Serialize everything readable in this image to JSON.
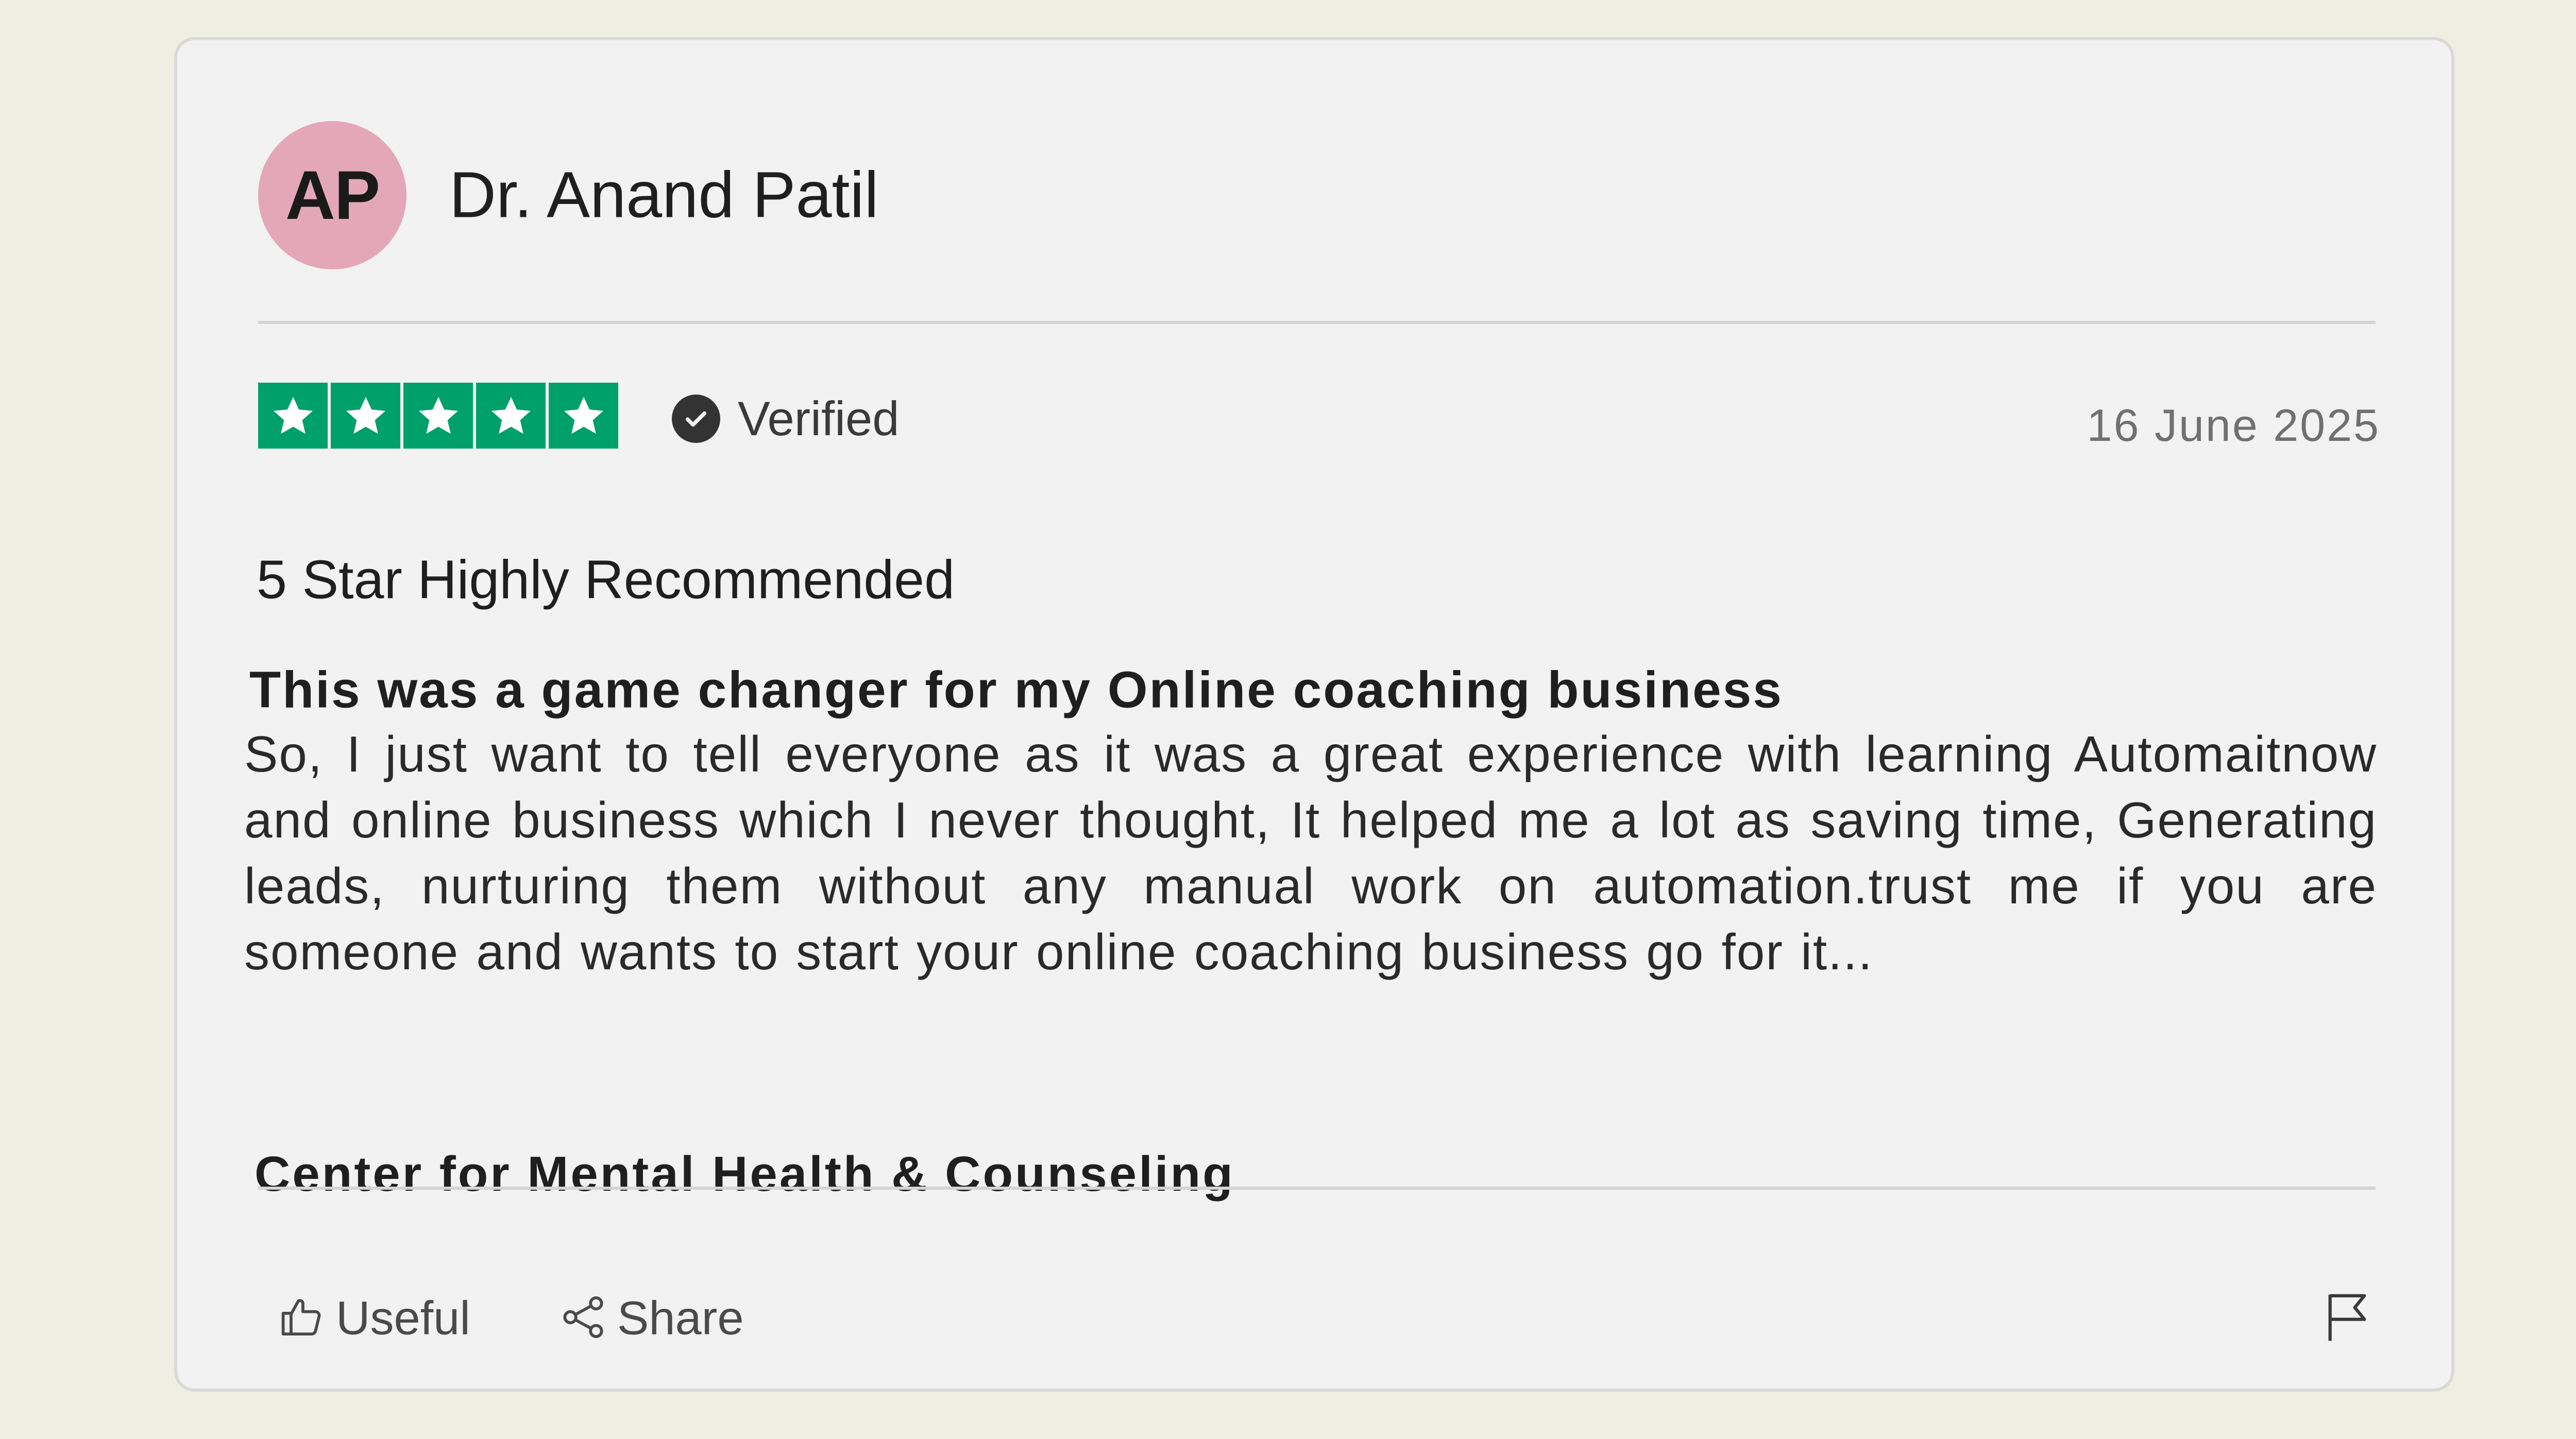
{
  "reviewer": {
    "initials": "AP",
    "name": "Dr. Anand Patil"
  },
  "rating": {
    "stars": 5,
    "max_stars": 5,
    "star_color": "#00a06a",
    "verified_label": "Verified"
  },
  "review": {
    "date": "16 June 2025",
    "headline": "5 Star Highly Recommended",
    "title": "This was a game changer for my Online coaching business",
    "body": "So, I just want to tell everyone as it was a great experience with learning Automaitnow and online business which I never thought, It helped me a lot as saving time, Generating leads, nurturing them without any manual work on automation.trust me if you are someone and wants to start your online coaching business go for it...",
    "organization": "Center for Mental Health & Counseling"
  },
  "actions": {
    "useful_label": "Useful",
    "share_label": "Share"
  },
  "icons": {
    "useful": "thumbs-up-icon",
    "share": "share-icon",
    "flag": "flag-icon",
    "verified": "check-circle-icon",
    "star": "star-icon"
  },
  "colors": {
    "background": "#eeeee2",
    "card": "#f2f2f2",
    "avatar": "#e4a7ba",
    "star_green": "#00a06a"
  }
}
